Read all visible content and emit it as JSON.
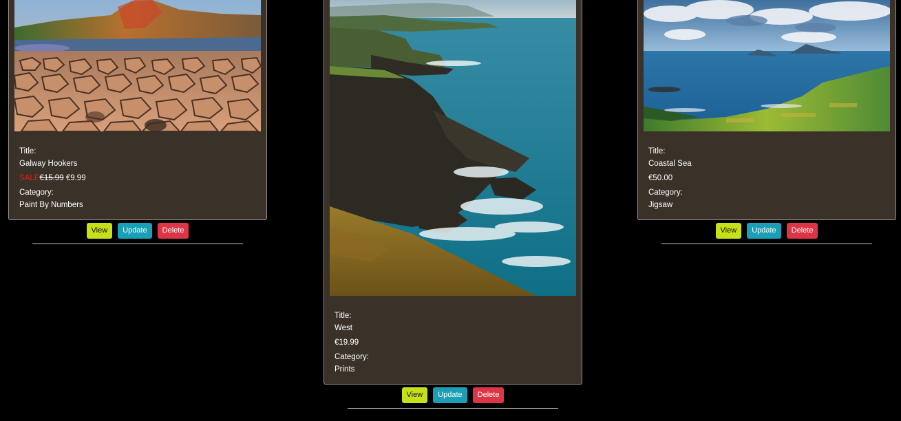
{
  "colors": {
    "background": "#000000",
    "card": "#3a3129",
    "sale": "#e02020",
    "view_button": "#c6e01a",
    "update_button": "#1a9fb7",
    "delete_button": "#dc3545"
  },
  "products": [
    {
      "image": "giants-causeway-hexagonal-basalt-stones-photo",
      "title_label": "Title:",
      "title": "Galway Hookers",
      "on_sale": true,
      "sale_label": "SALE",
      "old_price": "€15.99",
      "price": "€9.99",
      "category_label": "Category:",
      "category": "Paint By Numbers",
      "buttons": {
        "view": "View",
        "update": "Update",
        "delete": "Delete"
      }
    },
    {
      "image": "sea-cliffs-waves-coast-photo",
      "title_label": "Title:",
      "title": "West",
      "on_sale": false,
      "price": "€19.99",
      "category_label": "Category:",
      "category": "Prints",
      "buttons": {
        "view": "View",
        "update": "Update",
        "delete": "Delete"
      }
    },
    {
      "image": "coastal-sea-islands-green-fields-photo",
      "title_label": "Title:",
      "title": "Coastal Sea",
      "on_sale": false,
      "price": "€50.00",
      "category_label": "Category:",
      "category": "Jigsaw",
      "buttons": {
        "view": "View",
        "update": "Update",
        "delete": "Delete"
      }
    }
  ]
}
